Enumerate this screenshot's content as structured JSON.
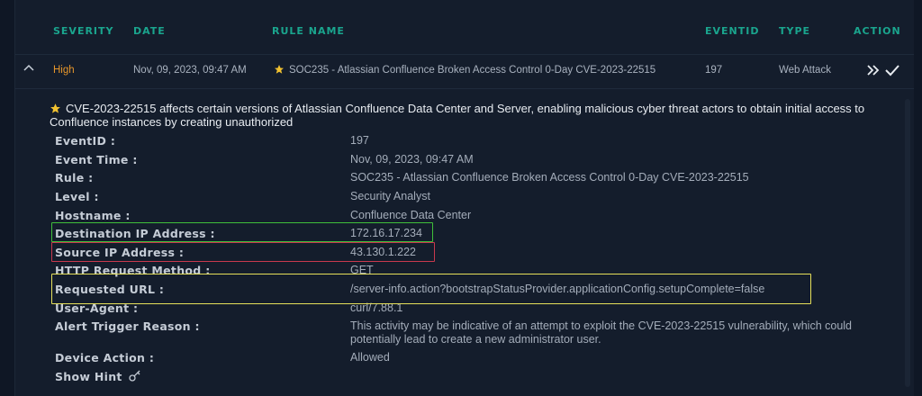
{
  "table": {
    "headers": {
      "severity": "SEVERITY",
      "date": "DATE",
      "rule_name": "RULE NAME",
      "eventid": "EVENTID",
      "type": "TYPE",
      "action": "ACTION"
    },
    "row": {
      "severity": "High",
      "date": "Nov, 09, 2023, 09:47 AM",
      "rule_name": "SOC235 - Atlassian Confluence Broken Access Control 0-Day CVE-2023-22515",
      "eventid": "197",
      "type": "Web Attack"
    }
  },
  "detail": {
    "headline": "CVE-2023-22515 affects certain versions of Atlassian Confluence Data Center and Server, enabling malicious cyber threat actors to obtain initial access to Confluence instances by creating unauthorized",
    "fields": [
      {
        "key": "EventID :",
        "value": "197"
      },
      {
        "key": "Event Time :",
        "value": "Nov, 09, 2023, 09:47 AM"
      },
      {
        "key": "Rule :",
        "value": "SOC235 - Atlassian Confluence Broken Access Control 0-Day CVE-2023-22515"
      },
      {
        "key": "Level :",
        "value": "Security Analyst"
      },
      {
        "key": "Hostname :",
        "value": "Confluence Data Center"
      },
      {
        "key": "Destination IP Address :",
        "value": "172.16.17.234"
      },
      {
        "key": "Source IP Address :",
        "value": "43.130.1.222"
      },
      {
        "key": "HTTP Request Method :",
        "value": "GET"
      },
      {
        "key": "Requested URL :",
        "value": "/server-info.action?bootstrapStatusProvider.applicationConfig.setupComplete=false"
      },
      {
        "key": "User-Agent :",
        "value": "curl/7.88.1"
      },
      {
        "key": "Alert Trigger Reason :",
        "value": "This activity may be indicative of an attempt to exploit the CVE-2023-22515 vulnerability, which could potentially lead to create a new administrator user."
      },
      {
        "key": "Device Action :",
        "value": "Allowed"
      },
      {
        "key": "Show Hint",
        "value": ""
      }
    ]
  },
  "colors": {
    "accent": "#1aa58e",
    "severity_high": "#e6962b",
    "highlight_green": "#3fbf3a",
    "highlight_red": "#c8394d",
    "highlight_yellow": "#e6e05a",
    "star": "#f2c230"
  },
  "icons": {
    "collapse": "chevron-up-icon",
    "star": "star-icon",
    "forward": "double-chevron-right-icon",
    "check": "check-icon",
    "hint": "key-icon"
  }
}
